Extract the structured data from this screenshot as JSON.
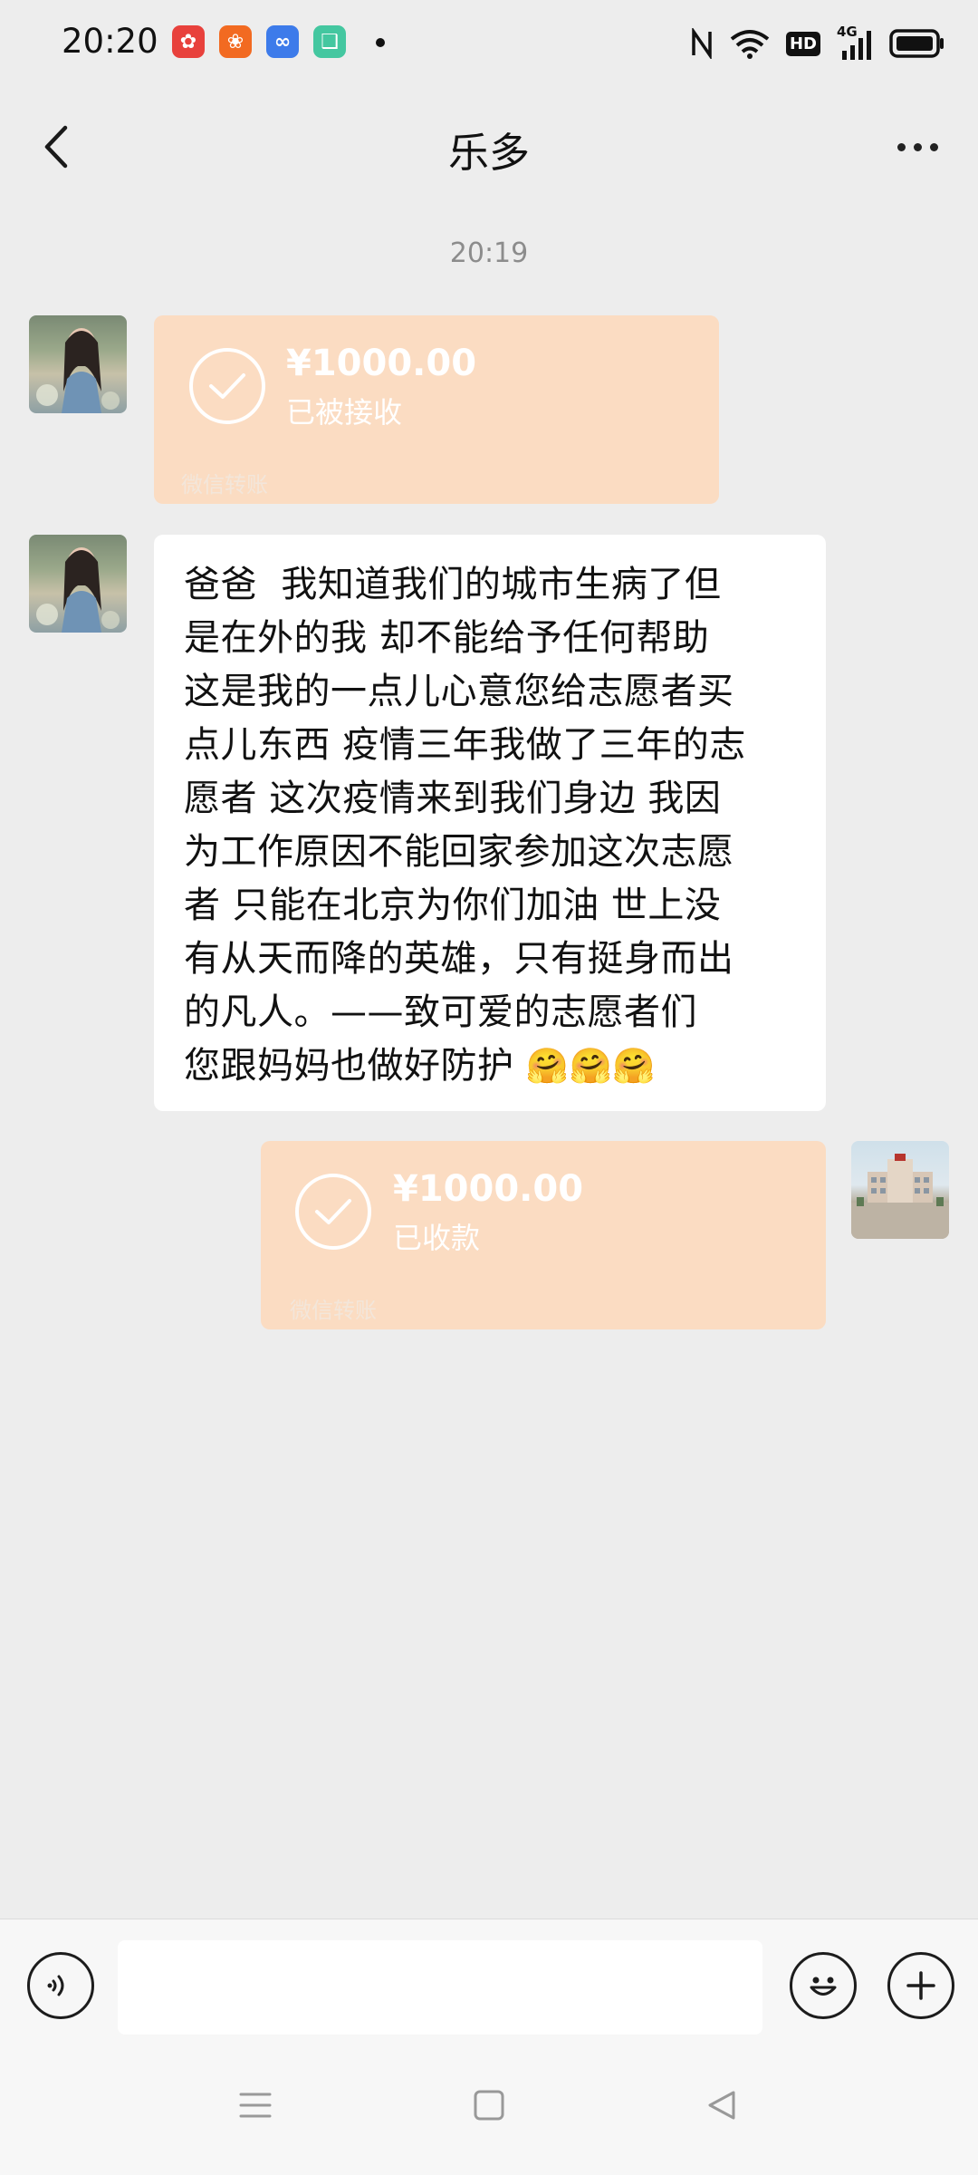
{
  "status_bar": {
    "time": "20:20",
    "icons": [
      "app-red-icon",
      "app-orange-icon",
      "app-blue-icon",
      "app-green-icon",
      "nfc-icon",
      "wifi-icon",
      "hd-icon",
      "signal-4g-icon",
      "battery-icon"
    ],
    "hd_label": "HD",
    "network_label": "4G"
  },
  "nav": {
    "title": "乐多"
  },
  "chat": {
    "timestamp": "20:19",
    "transfer_received": {
      "amount": "¥1000.00",
      "status": "已被接收",
      "footer": "微信转账"
    },
    "message": "爸爸  我知道我们的城市生病了但\n是在外的我 却不能给予任何帮助\n这是我的一点儿心意您给志愿者买\n点儿东西 疫情三年我做了三年的志\n愿者 这次疫情来到我们身边 我因\n为工作原因不能回家参加这次志愿\n者 只能在北京为你们加油 世上没\n有从天而降的英雄，只有挺身而出\n的凡人。——致可爱的志愿者们\n您跟妈妈也做好防护 ",
    "message_emoji": "🤗🤗🤗",
    "transfer_collected": {
      "amount": "¥1000.00",
      "status": "已收款",
      "footer": "微信转账"
    }
  },
  "input": {
    "value": "",
    "placeholder": ""
  },
  "colors": {
    "background": "#ededed",
    "transfer_card": "#fbdcc2",
    "bubble": "#ffffff"
  }
}
